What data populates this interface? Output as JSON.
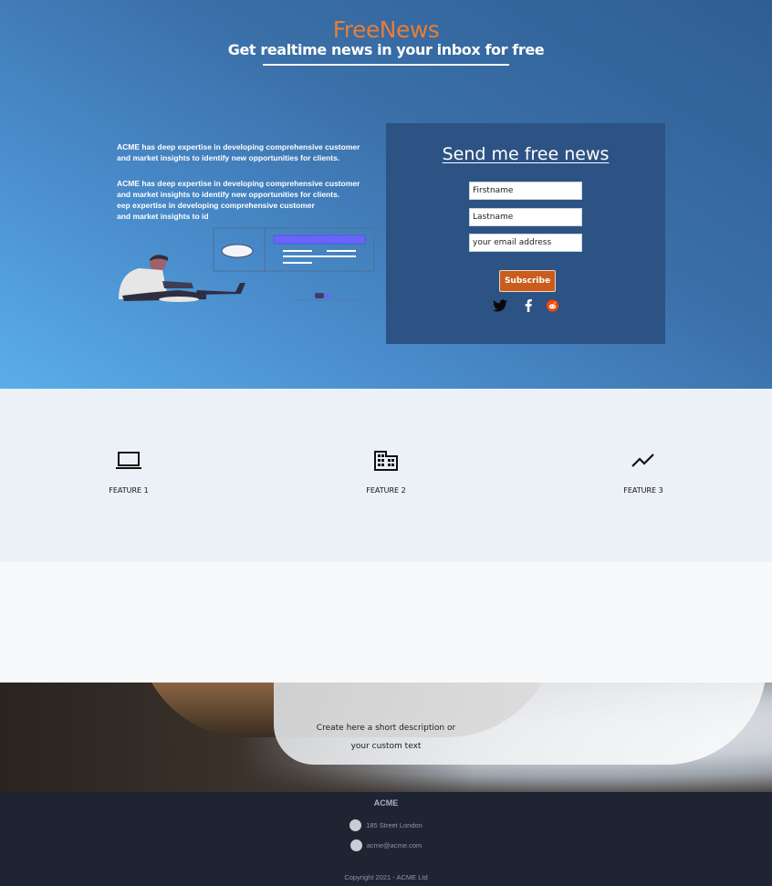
{
  "hero": {
    "brand": "FreeNews",
    "tagline": "Get realtime news in your inbox for free",
    "paragraph1": "ACME has deep expertise in developing comprehensive customer\nand market insights to identify new opportunities for clients.",
    "paragraph2": "ACME has deep expertise in developing comprehensive customer\nand market insights to identify new opportunities for clients.\neep expertise in developing comprehensive customer\nand market insights to id"
  },
  "form": {
    "title": "Send me free news",
    "firstname_placeholder": "Firstname",
    "lastname_placeholder": "Lastname",
    "email_placeholder": "your email address",
    "subscribe_label": "Subscribe",
    "social_icons": [
      "twitter-icon",
      "facebook-icon",
      "reddit-icon"
    ]
  },
  "features": [
    {
      "label": "FEATURE 1",
      "icon": "laptop-icon"
    },
    {
      "label": "FEATURE 2",
      "icon": "building-icon"
    },
    {
      "label": "FEATURE 3",
      "icon": "trending-up-icon"
    }
  ],
  "banner": {
    "text_line1": "Create here a short description or",
    "text_line2": "your custom text"
  },
  "footer": {
    "brand": "ACME",
    "address": "185 Street London",
    "email": "acme@acme.com",
    "copyright": "Copyright 2021 - ACME Ltd"
  },
  "colors": {
    "accent": "#e87d35",
    "button": "#c95d1e",
    "panel": "#2c5384",
    "footer": "#1f2432"
  }
}
